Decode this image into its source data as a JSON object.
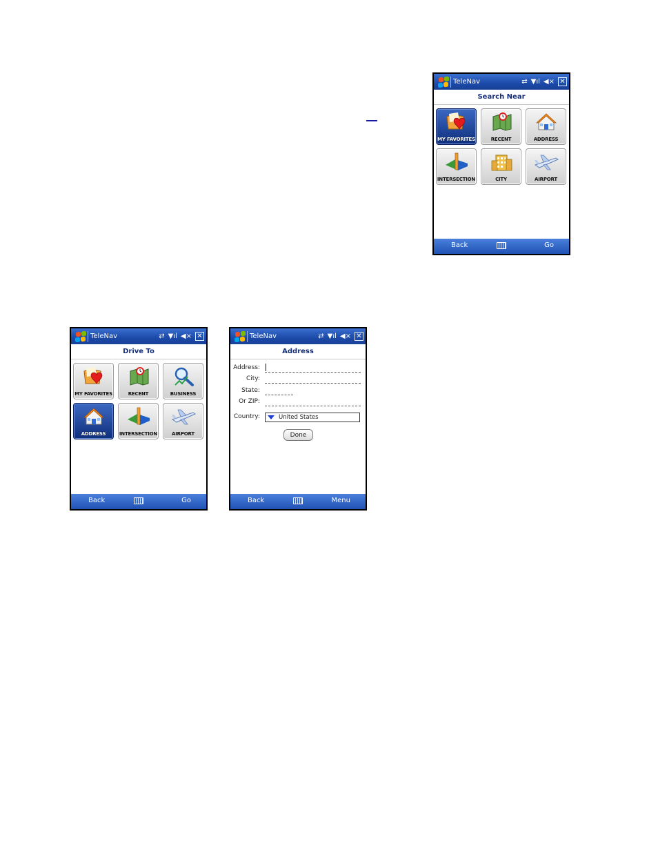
{
  "app_title": "TeleNav",
  "colors": {
    "title_bar": "#1c4aa8",
    "soft_bar": "#2f62c6",
    "header_text": "#16307a",
    "selected_tile": "#1d3f91"
  },
  "search_near": {
    "header": "Search Near",
    "tiles": [
      {
        "label": "MY FAVORITES",
        "icon": "favorites-folder-heart-icon",
        "selected": true
      },
      {
        "label": "RECENT",
        "icon": "recent-map-icon",
        "selected": false
      },
      {
        "label": "ADDRESS",
        "icon": "house-icon",
        "selected": false
      },
      {
        "label": "INTERSECTION",
        "icon": "intersection-icon",
        "selected": false
      },
      {
        "label": "CITY",
        "icon": "city-building-icon",
        "selected": false
      },
      {
        "label": "AIRPORT",
        "icon": "airplane-icon",
        "selected": false
      }
    ],
    "soft_left": "Back",
    "soft_right": "Go"
  },
  "drive_to": {
    "header": "Drive To",
    "tiles": [
      {
        "label": "MY FAVORITES",
        "icon": "favorites-folder-heart-icon",
        "selected": false
      },
      {
        "label": "RECENT",
        "icon": "recent-map-icon",
        "selected": false
      },
      {
        "label": "BUSINESS",
        "icon": "business-magnifier-icon",
        "selected": false
      },
      {
        "label": "ADDRESS",
        "icon": "house-icon",
        "selected": true
      },
      {
        "label": "INTERSECTION",
        "icon": "intersection-icon",
        "selected": false
      },
      {
        "label": "AIRPORT",
        "icon": "airplane-icon",
        "selected": false
      }
    ],
    "soft_left": "Back",
    "soft_right": "Go"
  },
  "address": {
    "header": "Address",
    "fields": {
      "address_label": "Address:",
      "city_label": "City:",
      "state_label": "State:",
      "zip_label": "Or ZIP:",
      "country_label": "Country:"
    },
    "country_value": "United States",
    "done_label": "Done",
    "soft_left": "Back",
    "soft_right": "Menu"
  }
}
